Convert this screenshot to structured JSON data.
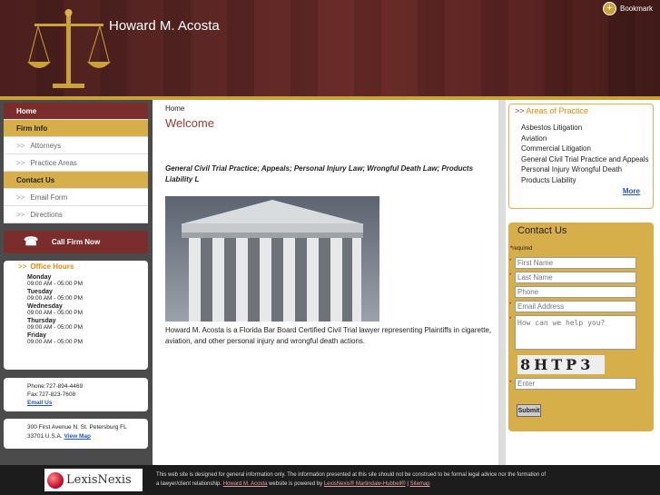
{
  "header": {
    "firm_name": "Howard M. Acosta",
    "bookmark_label": "Bookmark"
  },
  "nav": {
    "home": "Home",
    "firm_info": "Firm Info",
    "attorneys": "Attorneys",
    "practice_areas": "Practice Areas",
    "contact_us": "Contact Us",
    "email_form": "Email Form",
    "directions": "Directions"
  },
  "call_now": "Call Firm Now",
  "office_hours": {
    "title": "Office Hours",
    "days": [
      {
        "day": "Monday",
        "time": "09:00 AM - 05:00 PM"
      },
      {
        "day": "Tuesday",
        "time": "09:00 AM - 05:00 PM"
      },
      {
        "day": "Wednesday",
        "time": "09:00 AM - 05:00 PM"
      },
      {
        "day": "Thursday",
        "time": "09:00 AM - 05:00 PM"
      },
      {
        "day": "Friday",
        "time": "09:00 AM - 05:00 PM"
      }
    ]
  },
  "contact": {
    "phone": "Phone:727-894-4469",
    "fax": "Fax:727-823-7608",
    "email_link": "Email Us"
  },
  "address": {
    "line1": "300 First Avenue N. St. Petersburg FL",
    "line2": "33701 U.S.A.",
    "map_link": "View Map"
  },
  "main": {
    "breadcrumb": "Home",
    "heading": "Welcome",
    "subheading": "General Civil Trial Practice; Appeals; Personal Injury Law; Wrongful Death Law; Products Liability L",
    "intro": "Howard M. Acosta is a Florida Bar Board Certified Civil Trial lawyer representing Plaintiffs in cigarette, aviation, and other personal injury and wrongful death actions."
  },
  "areas": {
    "title": "Areas of Practice",
    "items": [
      "Asbestos Litigation",
      "Aviation",
      "Commercial Litigation",
      "General Civil Trial Practice and Appeals",
      "Personal Injury Wrongful Death",
      "Products Liability"
    ],
    "more": "More"
  },
  "form": {
    "title": "Contact Us",
    "required": "required",
    "first_name": "First Name",
    "last_name": "Last Name",
    "phone": "Phone",
    "email": "Email Address",
    "help": "How can we help you?",
    "captcha": "8HTP3",
    "enter": "Enter",
    "submit": "Submit"
  },
  "footer": {
    "logo_text": "LexisNexis",
    "text1": "This web site is designed for general information only. The information presented at this site should not be construed to be formal legal advice nor the formation of",
    "text2": "a lawyer/client relationship.",
    "link_firm": "Howard M. Acosta",
    "text3": "website is powered by",
    "link_lexis": "LexisNexis® Martindale-Hubbell®",
    "sep": "|",
    "link_sitemap": "Sitemap"
  },
  "colors": {
    "maroon": "#7a2d2a",
    "gold": "#d6ae4a",
    "orange": "#e08a12",
    "link": "#2255cc"
  }
}
